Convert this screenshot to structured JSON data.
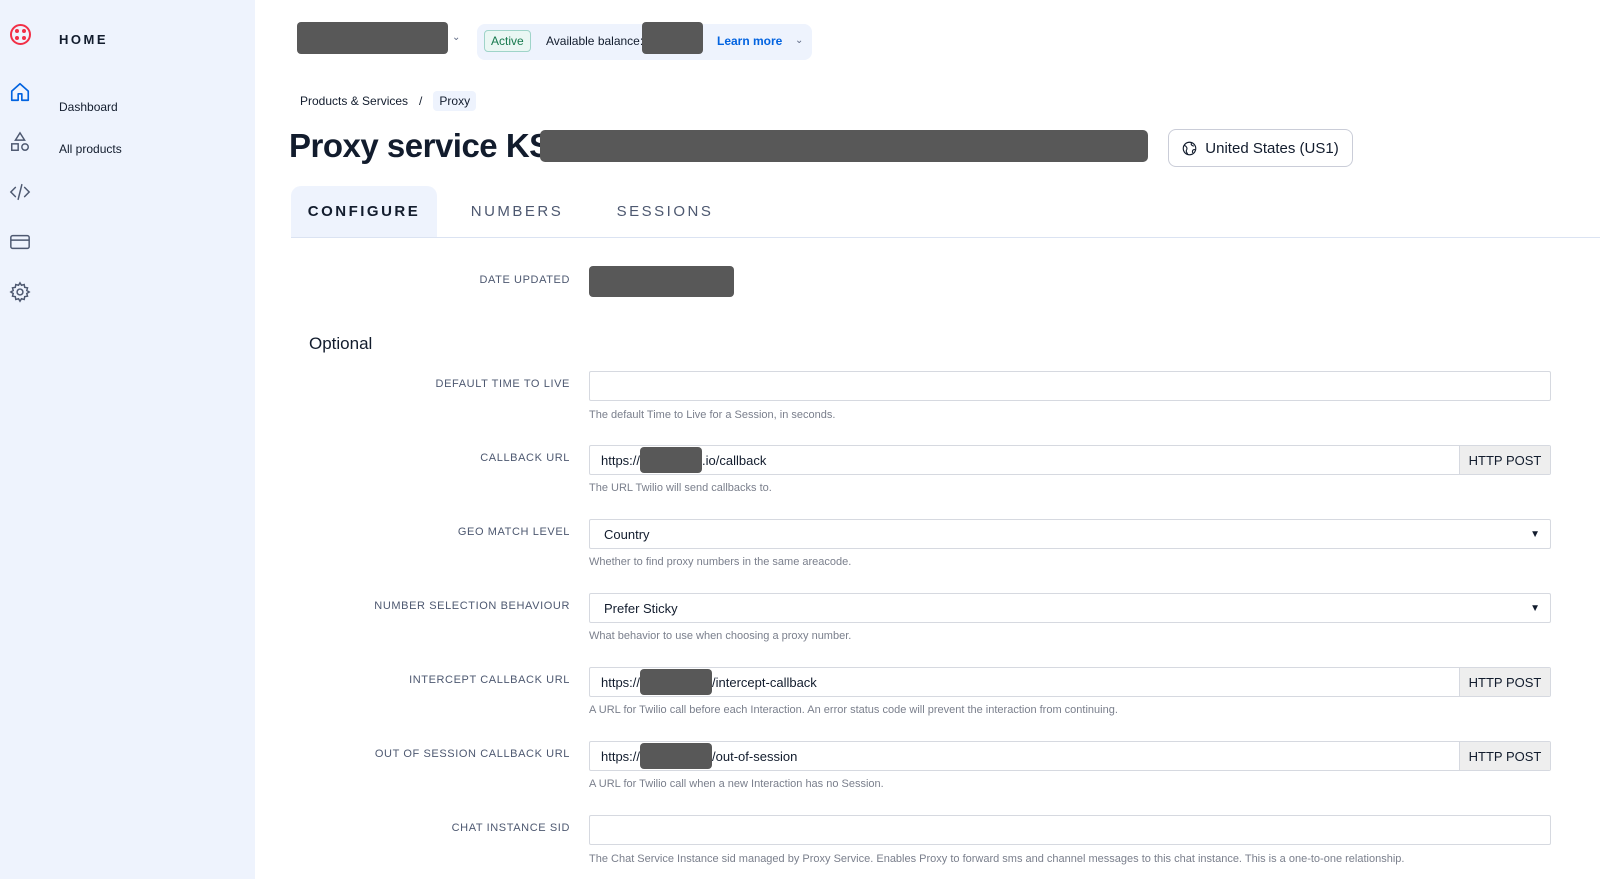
{
  "sidebar": {
    "title": "HOME",
    "items": [
      {
        "label": "Dashboard"
      },
      {
        "label": "All products"
      }
    ]
  },
  "topbar": {
    "status": "Active",
    "balance_label": "Available balance:",
    "learn_more": "Learn more"
  },
  "breadcrumb": {
    "items": [
      "Products & Services",
      "Proxy"
    ],
    "separator": "/"
  },
  "header": {
    "title": "Proxy service KS",
    "region": "United States (US1)"
  },
  "tabs": [
    {
      "label": "CONFIGURE",
      "active": true
    },
    {
      "label": "NUMBERS",
      "active": false
    },
    {
      "label": "SESSIONS",
      "active": false
    }
  ],
  "form": {
    "date_updated_label": "DATE UPDATED",
    "optional_heading": "Optional",
    "fields": {
      "default_ttl": {
        "label": "DEFAULT TIME TO LIVE",
        "value": "",
        "help": "The default Time to Live for a Session, in seconds."
      },
      "callback_url": {
        "label": "CALLBACK URL",
        "prefix": "https://",
        "suffix": ".io/callback",
        "method": "HTTP POST",
        "help": "The URL Twilio will send callbacks to."
      },
      "geo_match": {
        "label": "GEO MATCH LEVEL",
        "value": "Country",
        "help": "Whether to find proxy numbers in the same areacode."
      },
      "number_selection": {
        "label": "NUMBER SELECTION BEHAVIOUR",
        "value": "Prefer Sticky",
        "help": "What behavior to use when choosing a proxy number."
      },
      "intercept_callback": {
        "label": "INTERCEPT CALLBACK URL",
        "prefix": "https://",
        "suffix": "/intercept-callback",
        "method": "HTTP POST",
        "help": "A URL for Twilio call before each Interaction. An error status code will prevent the interaction from continuing."
      },
      "out_of_session": {
        "label": "OUT OF SESSION CALLBACK URL",
        "prefix": "https://",
        "suffix": "/out-of-session",
        "method": "HTTP POST",
        "help": "A URL for Twilio call when a new Interaction has no Session."
      },
      "chat_instance": {
        "label": "CHAT INSTANCE SID",
        "value": "",
        "help": "The Chat Service Instance sid managed by Proxy Service. Enables Proxy to forward sms and channel messages to this chat instance. This is a one-to-one relationship."
      }
    }
  },
  "icons": {
    "logo": "twilio-logo-icon",
    "rail": [
      "home-icon",
      "shapes-icon",
      "code-icon",
      "billing-card-icon",
      "gear-icon"
    ],
    "region": "globe-icon",
    "chevron": "chevron-down-icon"
  },
  "colors": {
    "sidebar_bg": "#eef3fd",
    "brand_red": "#f22f46",
    "link_blue": "#0263e0",
    "redaction": "#585858"
  }
}
